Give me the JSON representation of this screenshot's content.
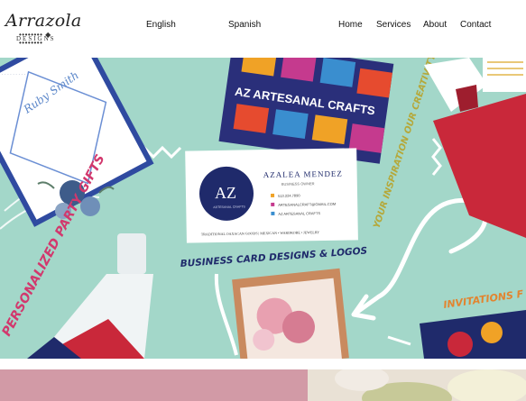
{
  "logo": {
    "script": "Arrazola",
    "dots": "•••••••• ◆ ••••••••",
    "sub": "DESIGNS"
  },
  "language": {
    "english": "English",
    "spanish": "Spanish"
  },
  "nav": {
    "home": "Home",
    "services": "Services",
    "about": "About",
    "contact": "Contact"
  },
  "hero": {
    "card_brand": "AZ ARTESANAL CRAFTS",
    "monogram": "AZ",
    "monogram_sub": "ARTESANAL CRAFTS",
    "owner_name": "AZALEA MENDEZ",
    "owner_title": "BUSINESS OWNER",
    "phone": "513.224.7890",
    "email": "ARTESANALCRAFT@GMAIL.COM",
    "social": "AZ ARTESANAL CRAFTS",
    "card_footer": "TRADITIONAL OAXACAN GOODS | MEXICAN • WARDROBE • JEWELRY",
    "label_gifts": "PERSONALIZED PARTY GIFTS",
    "label_cards": "BUSINESS CARD DESIGNS & LOGOS",
    "label_inspiration": "YOUR INSPIRATION OUR CREATIVITY",
    "label_invites": "INVITATIONS F",
    "invite_name": "Ruby Smith"
  },
  "colors": {
    "hero_bg": "#a3d7c9",
    "pink_block": "#d29aa6",
    "navy": "#1f2a6b",
    "red": "#c9283a"
  }
}
